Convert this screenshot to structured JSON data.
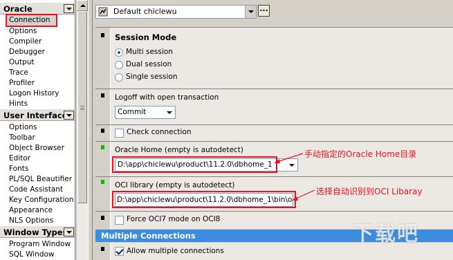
{
  "nav": {
    "categories": [
      {
        "label": "Oracle",
        "items": [
          "Connection",
          "Options",
          "Compiler",
          "Debugger",
          "Output",
          "Trace",
          "Profiler",
          "Logon History",
          "Hints"
        ]
      },
      {
        "label": "User Interface",
        "items": [
          "Options",
          "Toolbar",
          "Object Browser",
          "Editor",
          "Fonts",
          "PL/SQL Beautifier",
          "Code Assistant",
          "Key Configuration",
          "Appearance",
          "NLS Options"
        ]
      },
      {
        "label": "Window Types",
        "items": [
          "Program Window",
          "SQL Window"
        ]
      }
    ],
    "selected": "Connection"
  },
  "profile": {
    "value": "Default chiclewu",
    "more_button": "..."
  },
  "session_mode": {
    "title": "Session Mode",
    "options": [
      "Multi session",
      "Dual session",
      "Single session"
    ],
    "selected_index": 0
  },
  "logoff": {
    "label": "Logoff with open transaction",
    "value": "Commit"
  },
  "check_connection": {
    "label": "Check connection",
    "checked": false
  },
  "oracle_home": {
    "label": "Oracle Home (empty is autodetect)",
    "value": "D:\\app\\chiclewu\\product\\11.2.0\\dbhome_1"
  },
  "oci_library": {
    "label": "OCI library (empty is autodetect)",
    "value": "D:\\app\\chiclewu\\product\\11.2.0\\dbhome_1\\bin\\o..."
  },
  "force_oci7": {
    "label": "Force OCI7 mode on OCI8",
    "checked": false
  },
  "multiple_connections": {
    "title": "Multiple Connections",
    "allow_label": "Allow multiple connections",
    "allow_checked": true
  },
  "annotations": {
    "oracle_home_note": "手动指定的Oracle Home目录",
    "oci_note": "选择自动识别到OCI Libaray"
  },
  "watermark": "下载吧",
  "colors": {
    "highlight_red": "#e8111e",
    "section_band": "#3b8de0",
    "green_marker": "#00c000"
  }
}
